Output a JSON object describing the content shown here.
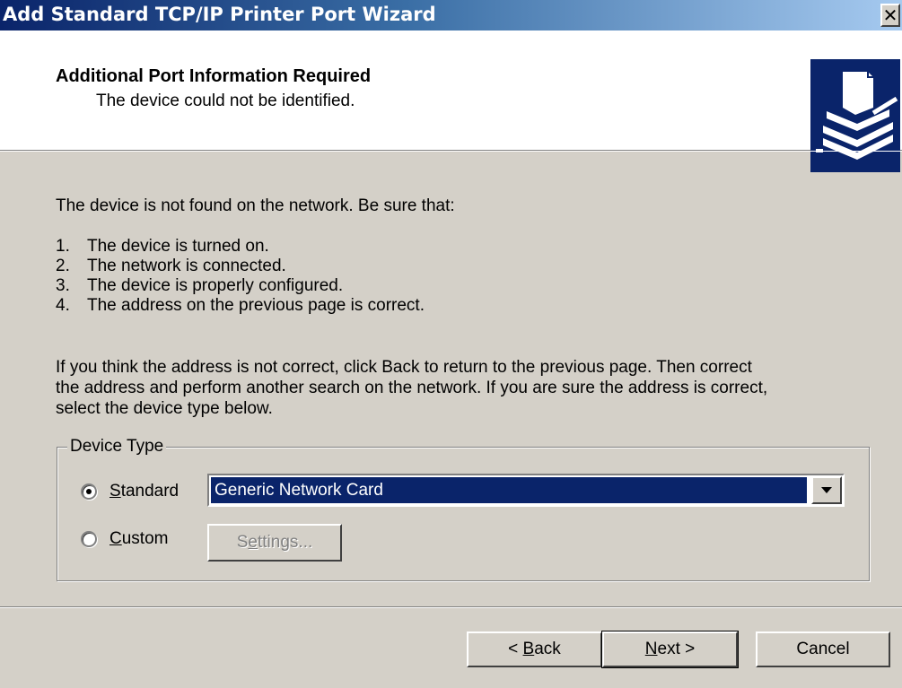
{
  "window": {
    "title": "Add Standard TCP/IP Printer Port Wizard",
    "close_glyph": "✕"
  },
  "header": {
    "title": "Additional Port Information Required",
    "subtitle": "The device could not be identified.",
    "icon": "printer-port-icon"
  },
  "body": {
    "intro": "The device is not found on the network.  Be sure that:",
    "checklist": [
      {
        "num": "1.",
        "text": "The device is turned on."
      },
      {
        "num": "2.",
        "text": "The network is connected."
      },
      {
        "num": "3.",
        "text": "The device is properly configured."
      },
      {
        "num": "4.",
        "text": "The address on the previous page is correct."
      }
    ],
    "paragraph_lines": [
      "If you think the address is not correct, click Back to return to the previous page.  Then correct",
      "the address and perform another search on the network.  If you are sure the address is correct,",
      "select the device type below."
    ]
  },
  "device_type": {
    "legend": "Device Type",
    "standard": {
      "mnemonic": "S",
      "rest": "tandard",
      "checked": true
    },
    "custom": {
      "mnemonic": "C",
      "rest": "ustom",
      "checked": false
    },
    "standard_select_value": "Generic Network Card",
    "settings_button": {
      "before": "S",
      "mnemonic": "e",
      "after": "ttings...",
      "enabled": false
    }
  },
  "footer": {
    "back": {
      "prefix": "< ",
      "mnemonic": "B",
      "rest": "ack"
    },
    "next": {
      "mnemonic": "N",
      "rest": "ext >"
    },
    "cancel": "Cancel"
  },
  "colors": {
    "title_gradient_start": "#0a246a",
    "title_gradient_end": "#a6caf0",
    "face": "#d4d0c8",
    "selection": "#0a246a"
  }
}
